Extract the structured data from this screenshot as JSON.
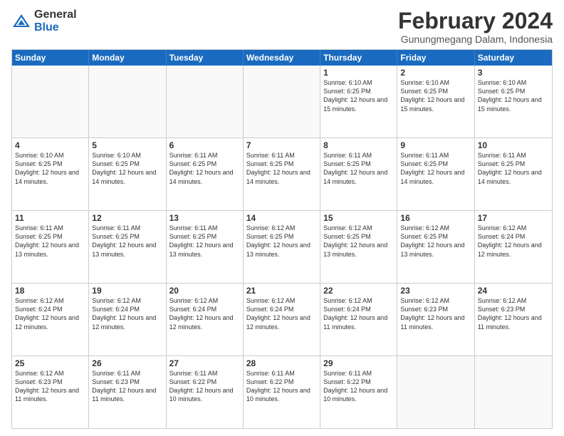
{
  "logo": {
    "general": "General",
    "blue": "Blue"
  },
  "title": "February 2024",
  "location": "Gunungmegang Dalam, Indonesia",
  "header_days": [
    "Sunday",
    "Monday",
    "Tuesday",
    "Wednesday",
    "Thursday",
    "Friday",
    "Saturday"
  ],
  "weeks": [
    [
      {
        "day": "",
        "info": ""
      },
      {
        "day": "",
        "info": ""
      },
      {
        "day": "",
        "info": ""
      },
      {
        "day": "",
        "info": ""
      },
      {
        "day": "1",
        "info": "Sunrise: 6:10 AM\nSunset: 6:25 PM\nDaylight: 12 hours and 15 minutes."
      },
      {
        "day": "2",
        "info": "Sunrise: 6:10 AM\nSunset: 6:25 PM\nDaylight: 12 hours and 15 minutes."
      },
      {
        "day": "3",
        "info": "Sunrise: 6:10 AM\nSunset: 6:25 PM\nDaylight: 12 hours and 15 minutes."
      }
    ],
    [
      {
        "day": "4",
        "info": "Sunrise: 6:10 AM\nSunset: 6:25 PM\nDaylight: 12 hours and 14 minutes."
      },
      {
        "day": "5",
        "info": "Sunrise: 6:10 AM\nSunset: 6:25 PM\nDaylight: 12 hours and 14 minutes."
      },
      {
        "day": "6",
        "info": "Sunrise: 6:11 AM\nSunset: 6:25 PM\nDaylight: 12 hours and 14 minutes."
      },
      {
        "day": "7",
        "info": "Sunrise: 6:11 AM\nSunset: 6:25 PM\nDaylight: 12 hours and 14 minutes."
      },
      {
        "day": "8",
        "info": "Sunrise: 6:11 AM\nSunset: 6:25 PM\nDaylight: 12 hours and 14 minutes."
      },
      {
        "day": "9",
        "info": "Sunrise: 6:11 AM\nSunset: 6:25 PM\nDaylight: 12 hours and 14 minutes."
      },
      {
        "day": "10",
        "info": "Sunrise: 6:11 AM\nSunset: 6:25 PM\nDaylight: 12 hours and 14 minutes."
      }
    ],
    [
      {
        "day": "11",
        "info": "Sunrise: 6:11 AM\nSunset: 6:25 PM\nDaylight: 12 hours and 13 minutes."
      },
      {
        "day": "12",
        "info": "Sunrise: 6:11 AM\nSunset: 6:25 PM\nDaylight: 12 hours and 13 minutes."
      },
      {
        "day": "13",
        "info": "Sunrise: 6:11 AM\nSunset: 6:25 PM\nDaylight: 12 hours and 13 minutes."
      },
      {
        "day": "14",
        "info": "Sunrise: 6:12 AM\nSunset: 6:25 PM\nDaylight: 12 hours and 13 minutes."
      },
      {
        "day": "15",
        "info": "Sunrise: 6:12 AM\nSunset: 6:25 PM\nDaylight: 12 hours and 13 minutes."
      },
      {
        "day": "16",
        "info": "Sunrise: 6:12 AM\nSunset: 6:25 PM\nDaylight: 12 hours and 13 minutes."
      },
      {
        "day": "17",
        "info": "Sunrise: 6:12 AM\nSunset: 6:24 PM\nDaylight: 12 hours and 12 minutes."
      }
    ],
    [
      {
        "day": "18",
        "info": "Sunrise: 6:12 AM\nSunset: 6:24 PM\nDaylight: 12 hours and 12 minutes."
      },
      {
        "day": "19",
        "info": "Sunrise: 6:12 AM\nSunset: 6:24 PM\nDaylight: 12 hours and 12 minutes."
      },
      {
        "day": "20",
        "info": "Sunrise: 6:12 AM\nSunset: 6:24 PM\nDaylight: 12 hours and 12 minutes."
      },
      {
        "day": "21",
        "info": "Sunrise: 6:12 AM\nSunset: 6:24 PM\nDaylight: 12 hours and 12 minutes."
      },
      {
        "day": "22",
        "info": "Sunrise: 6:12 AM\nSunset: 6:24 PM\nDaylight: 12 hours and 11 minutes."
      },
      {
        "day": "23",
        "info": "Sunrise: 6:12 AM\nSunset: 6:23 PM\nDaylight: 12 hours and 11 minutes."
      },
      {
        "day": "24",
        "info": "Sunrise: 6:12 AM\nSunset: 6:23 PM\nDaylight: 12 hours and 11 minutes."
      }
    ],
    [
      {
        "day": "25",
        "info": "Sunrise: 6:12 AM\nSunset: 6:23 PM\nDaylight: 12 hours and 11 minutes."
      },
      {
        "day": "26",
        "info": "Sunrise: 6:11 AM\nSunset: 6:23 PM\nDaylight: 12 hours and 11 minutes."
      },
      {
        "day": "27",
        "info": "Sunrise: 6:11 AM\nSunset: 6:22 PM\nDaylight: 12 hours and 10 minutes."
      },
      {
        "day": "28",
        "info": "Sunrise: 6:11 AM\nSunset: 6:22 PM\nDaylight: 12 hours and 10 minutes."
      },
      {
        "day": "29",
        "info": "Sunrise: 6:11 AM\nSunset: 6:22 PM\nDaylight: 12 hours and 10 minutes."
      },
      {
        "day": "",
        "info": ""
      },
      {
        "day": "",
        "info": ""
      }
    ]
  ]
}
